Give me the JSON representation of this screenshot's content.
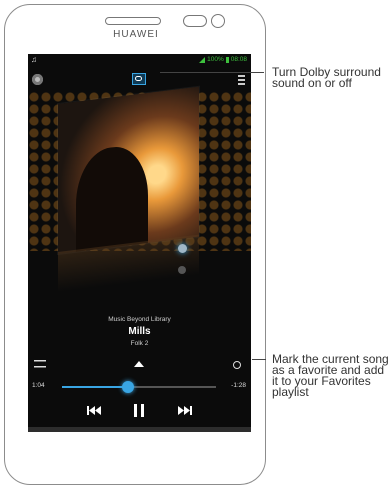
{
  "device": {
    "brand": "HUAWEI"
  },
  "status_bar": {
    "music_glyph": "♫",
    "battery": "100%",
    "time": "08:08"
  },
  "player": {
    "album_line": "Music Beyond Library",
    "song_title": "Mills",
    "artist_line": "Folk 2",
    "elapsed": "1:04",
    "remaining": "-1:28",
    "progress": 0.43
  },
  "nav_bar": {
    "back_glyph": "⮌"
  },
  "icons": {
    "top_left": "disc-icon",
    "top_center": "dolby-icon",
    "top_right": "menu-icon",
    "shuffle": "shuffle-icon",
    "up": "chevron-up-icon",
    "favorite": "favorite-icon",
    "prev": "previous-icon",
    "pause": "pause-icon",
    "next": "next-icon"
  },
  "colors": {
    "accent": "#39a5e3",
    "status": "#3ec13e"
  },
  "annotations": [
    {
      "text": "Turn Dolby surround sound on or off"
    },
    {
      "text": "Mark the current song as a favorite and add it to your Favorites playlist"
    }
  ]
}
